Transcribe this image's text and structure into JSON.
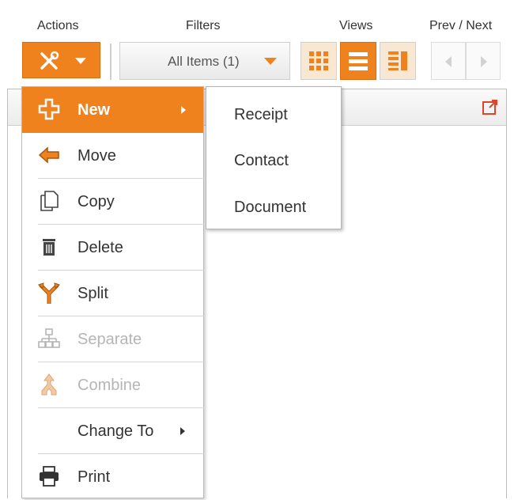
{
  "toolbar": {
    "actions_label": "Actions",
    "filters_label": "Filters",
    "views_label": "Views",
    "prevnext_label": "Prev / Next",
    "filter_value": "All Items (1)"
  },
  "colors": {
    "accent": "#f0821e",
    "accent_light": "#f8e7d3",
    "disabled": "#b5b5b5"
  },
  "menu": {
    "items": [
      {
        "label": "New",
        "icon": "plus-icon",
        "state": "active",
        "has_submenu": true
      },
      {
        "label": "Move",
        "icon": "arrow-left-icon",
        "state": "enabled"
      },
      {
        "label": "Copy",
        "icon": "copy-icon",
        "state": "enabled"
      },
      {
        "label": "Delete",
        "icon": "trash-icon",
        "state": "enabled"
      },
      {
        "label": "Split",
        "icon": "split-icon",
        "state": "enabled"
      },
      {
        "label": "Separate",
        "icon": "separate-icon",
        "state": "disabled"
      },
      {
        "label": "Combine",
        "icon": "combine-icon",
        "state": "disabled"
      },
      {
        "label": "Change To",
        "icon": "",
        "state": "enabled",
        "has_submenu": true
      },
      {
        "label": "Print",
        "icon": "printer-icon",
        "state": "enabled"
      }
    ]
  },
  "submenu": {
    "items": [
      {
        "label": "Receipt"
      },
      {
        "label": "Contact"
      },
      {
        "label": "Document"
      }
    ]
  }
}
